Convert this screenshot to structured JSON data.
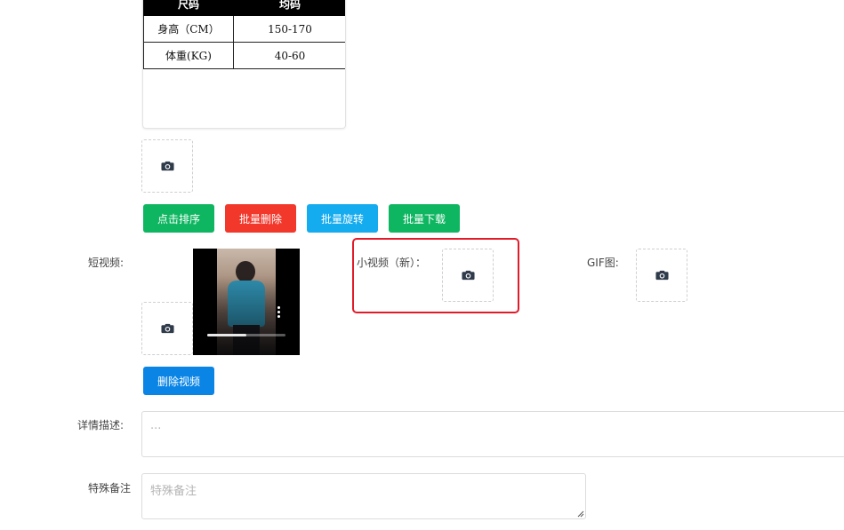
{
  "size_table": {
    "headers": [
      "尺码",
      "均码"
    ],
    "rows": [
      [
        "身高（CM）",
        "150-170"
      ],
      [
        "体重(KG)",
        "40-60"
      ]
    ]
  },
  "buttons": {
    "sort": "点击排序",
    "batch_delete": "批量删除",
    "batch_rotate": "批量旋转",
    "batch_download": "批量下载",
    "delete_video": "删除视频"
  },
  "labels": {
    "short_video": "短视频:",
    "mini_video": "小视频（新）：",
    "gif": "GIF图:",
    "detail": "详情描述:",
    "remark": "特殊备注"
  },
  "inputs": {
    "detail_placeholder": "...",
    "remark_placeholder": "特殊备注"
  },
  "video": {
    "progress": 0.5
  },
  "colors": {
    "green": "#0fb661",
    "red": "#f2372b",
    "cyan": "#14abef",
    "blue": "#0a85e6",
    "highlight": "#e21b2a"
  },
  "icons": [
    "camera-icon",
    "more-vertical-icon"
  ]
}
